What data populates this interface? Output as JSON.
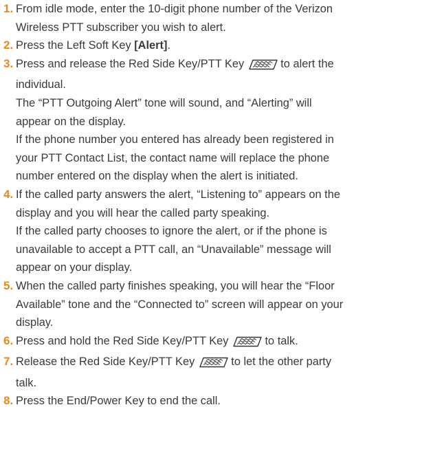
{
  "steps": [
    {
      "num": "1.",
      "lines": [
        "From idle mode, enter the 10-digit phone number of the Verizon",
        "Wireless PTT subscriber you wish to alert."
      ]
    },
    {
      "num": "2.",
      "pre": "Press the Left Soft Key ",
      "bold": "[Alert]",
      "post": "."
    },
    {
      "num": "3.",
      "pre": "Press and release the Red Side Key/PTT Key",
      "post": "to alert the",
      "lines": [
        "individual.",
        "The “PTT Outgoing Alert” tone will sound, and “Alerting” will",
        "appear on the display.",
        "If the phone number you entered has already been registered in",
        "your PTT Contact List, the contact name will replace the phone",
        "number entered on the display when the alert is initiated."
      ]
    },
    {
      "num": "4.",
      "lines": [
        "If the called party answers the alert, “Listening to” appears on the",
        "display and you will hear the called party speaking.",
        "If the called party chooses to ignore the alert, or if the phone is",
        "unavailable to accept a PTT call, an “Unavailable” message will",
        "appear on your display."
      ]
    },
    {
      "num": "5.",
      "lines": [
        "When the called party finishes speaking, you will hear the “Floor",
        "Available” tone and the “Connected to” screen will appear on your",
        "display."
      ]
    },
    {
      "num": "6.",
      "pre": "Press and hold the Red Side Key/PTT Key",
      "post": "to talk."
    },
    {
      "num": "7.",
      "pre": "Release the Red Side Key/PTT Key",
      "post": "to let the other party",
      "lines": [
        "talk."
      ]
    },
    {
      "num": "8.",
      "lines": [
        "Press the End/Power Key to end the call."
      ]
    }
  ],
  "icons": {
    "ptt_key": "ptt-side-key-icon"
  },
  "colors": {
    "step_number": "#e8891d",
    "text": "#3a3a3a"
  }
}
